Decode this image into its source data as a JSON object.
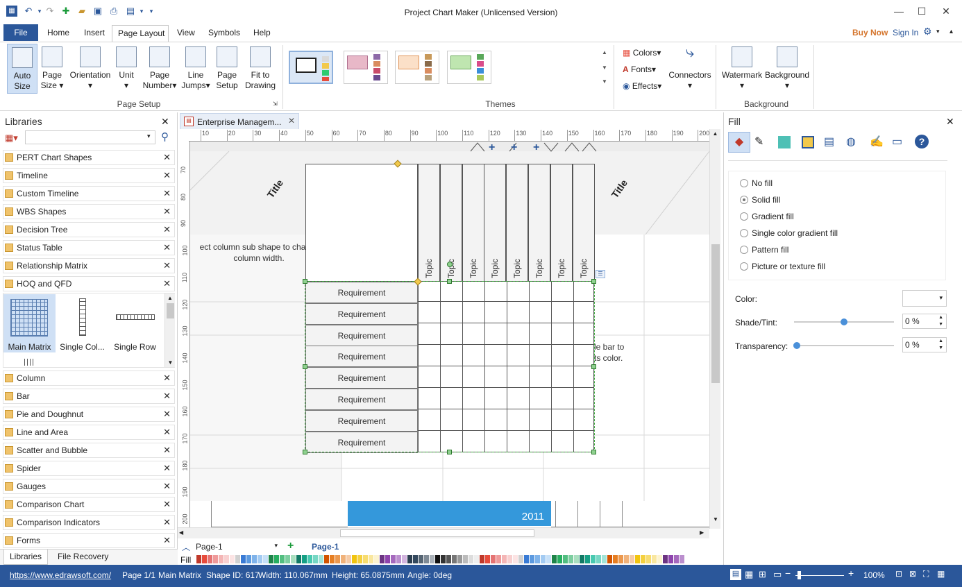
{
  "window": {
    "title": "Project Chart Maker (Unlicensed Version)",
    "minimize": "—",
    "maximize": "☐",
    "close": "✕"
  },
  "menu": {
    "file": "File",
    "tabs": [
      "Home",
      "Insert",
      "Page Layout",
      "View",
      "Symbols",
      "Help"
    ],
    "buy_now": "Buy Now",
    "sign_in": "Sign In"
  },
  "ribbon": {
    "page_setup": {
      "group_label": "Page Setup",
      "buttons": [
        {
          "line1": "Auto",
          "line2": "Size"
        },
        {
          "line1": "Page",
          "line2": "Size"
        },
        {
          "line1": "Orientation",
          "line2": ""
        },
        {
          "line1": "Unit",
          "line2": ""
        },
        {
          "line1": "Page",
          "line2": "Number"
        },
        {
          "line1": "Line",
          "line2": "Jumps"
        },
        {
          "line1": "Page",
          "line2": "Setup"
        },
        {
          "line1": "Fit to",
          "line2": "Drawing"
        }
      ]
    },
    "themes": {
      "group_label": "Themes",
      "colors": "Colors",
      "fonts": "Fonts",
      "effects": "Effects",
      "connectors": "Connectors"
    },
    "background": {
      "group_label": "Background",
      "watermark": "Watermark",
      "background": "Background"
    }
  },
  "libraries": {
    "title": "Libraries",
    "search_placeholder": "",
    "items": [
      "PERT Chart Shapes",
      "Timeline",
      "Custom Timeline",
      "WBS Shapes",
      "Decision Tree",
      "Status Table",
      "Relationship Matrix",
      "HOQ and QFD"
    ],
    "shapes": [
      "Main Matrix",
      "Single Col...",
      "Single Row"
    ],
    "items_after": [
      "Column",
      "Bar",
      "Pie and Doughnut",
      "Line and Area",
      "Scatter and Bubble",
      "Spider",
      "Gauges",
      "Comparison Chart",
      "Comparison Indicators",
      "Forms"
    ],
    "bottom_tabs": [
      "Libraries",
      "File Recovery"
    ]
  },
  "document": {
    "tab_title": "Enterprise Managem...",
    "ruler_top": [
      "10",
      "20",
      "30",
      "40",
      "50",
      "60",
      "70",
      "80",
      "90",
      "100",
      "110",
      "120",
      "130",
      "140",
      "150",
      "160",
      "170",
      "180",
      "190",
      "200"
    ],
    "ruler_left": [
      "70",
      "80",
      "90",
      "100",
      "110",
      "120",
      "130",
      "140",
      "150",
      "160",
      "170",
      "180",
      "190",
      "200"
    ],
    "left_title": "Title",
    "right_title": "Title",
    "hint_left_1": "ect column sub shape to cha",
    "hint_left_2": "column width.",
    "hint_right_1": "le bar to",
    "hint_right_2": "ts color.",
    "topics": [
      "Topic",
      "Topic",
      "Topic",
      "Topic",
      "Topic",
      "Topic",
      "Topic",
      "Topic"
    ],
    "requirements": [
      "Requirement",
      "Requirement",
      "Requirement",
      "Requirement",
      "Requirement",
      "Requirement",
      "Requirement",
      "Requirement"
    ],
    "year": "2011",
    "page_select": "Page-1",
    "page_tab": "Page-1",
    "fill_label": "Fill"
  },
  "fill_panel": {
    "title": "Fill",
    "options": [
      "No fill",
      "Solid fill",
      "Gradient fill",
      "Single color gradient fill",
      "Pattern fill",
      "Picture or texture fill"
    ],
    "selected_option": "Solid fill",
    "color_label": "Color:",
    "shade_label": "Shade/Tint:",
    "shade_value": "0 %",
    "transparency_label": "Transparency:",
    "transparency_value": "0 %"
  },
  "status": {
    "url": "https://www.edrawsoft.com/",
    "page": "Page 1/1",
    "shape": "Main Matrix",
    "shape_id": "Shape ID: 617",
    "width": "Width: 110.067mm",
    "height": "Height: 65.0875mm",
    "angle": "Angle: 0deg",
    "zoom": "100%"
  },
  "colors": {
    "accent": "#2b579a",
    "buy_now": "#d5752d",
    "year_bar": "#3498db"
  }
}
